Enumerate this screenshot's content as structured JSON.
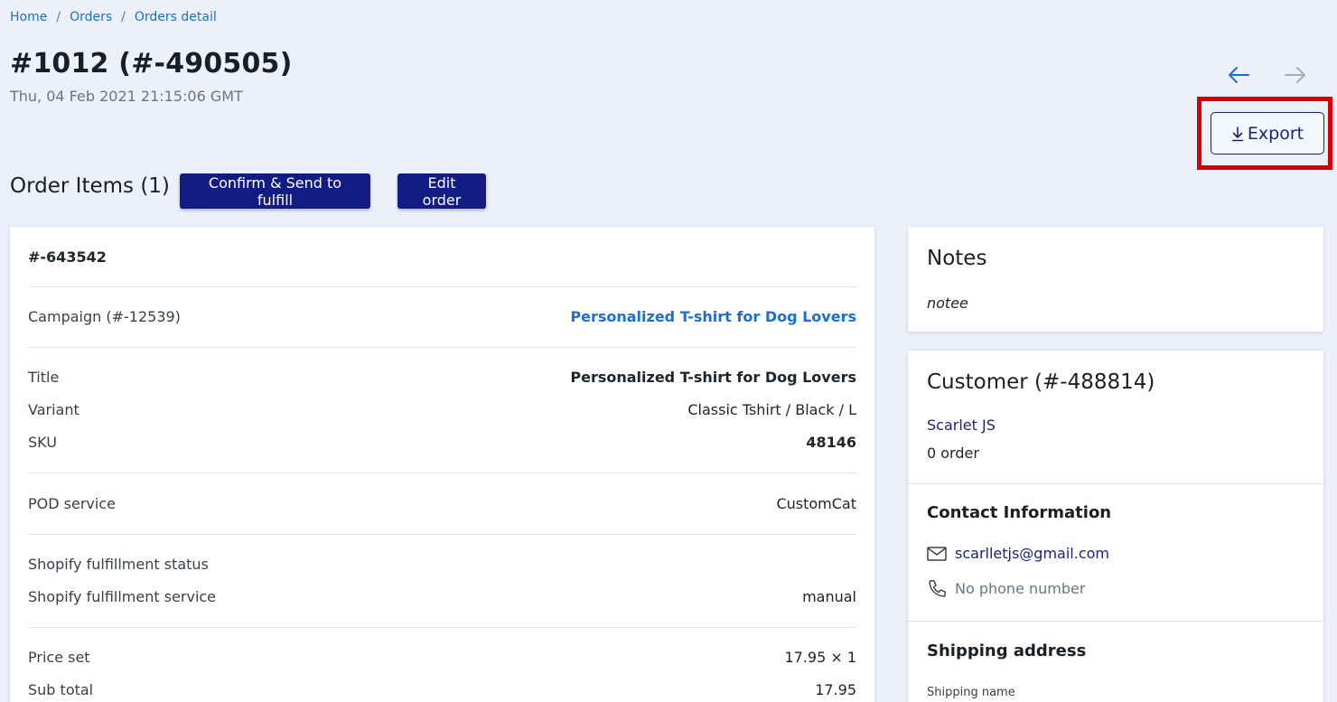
{
  "breadcrumb": {
    "items": [
      "Home",
      "Orders",
      "Orders detail"
    ],
    "separator": "/"
  },
  "order": {
    "title": "#1012 (#-490505)",
    "date": "Thu, 04 Feb 2021 21:15:06 GMT"
  },
  "nav": {
    "prev_icon": "arrow-left-icon",
    "next_icon": "arrow-right-icon"
  },
  "toolbar": {
    "export_label": "Export",
    "export_icon": "download-icon"
  },
  "items_section": {
    "title": "Order Items (1)",
    "confirm_label": "Confirm & Send to fulfill",
    "edit_label": "Edit order"
  },
  "item": {
    "id": "#-643542",
    "campaign_label": "Campaign (#-12539)",
    "campaign_value": "Personalized T-shirt for Dog Lovers",
    "title_label": "Title",
    "title_value": "Personalized T-shirt for Dog Lovers",
    "variant_label": "Variant",
    "variant_value": "Classic Tshirt / Black / L",
    "sku_label": "SKU",
    "sku_value": "48146",
    "pod_label": "POD service",
    "pod_value": "CustomCat",
    "shopify_status_label": "Shopify fulfillment status",
    "shopify_status_value": "",
    "shopify_service_label": "Shopify fulfillment service",
    "shopify_service_value": "manual",
    "price_set_label": "Price set",
    "price_set_value": "17.95 × 1",
    "subtotal_label": "Sub total",
    "subtotal_value": "17.95"
  },
  "notes": {
    "title": "Notes",
    "text": "notee"
  },
  "customer": {
    "title": "Customer (#-488814)",
    "name": "Scarlet JS",
    "orders": "0 order",
    "contact_title": "Contact Information",
    "email": "scarlletjs@gmail.com",
    "phone": "No phone number",
    "email_icon": "mail-icon",
    "phone_icon": "phone-icon",
    "shipping_title": "Shipping address",
    "shipping_name_label": "Shipping name"
  },
  "colors": {
    "background": "#ecf0fa",
    "primary_dark": "#131c82",
    "link": "#1a6fd6",
    "highlight": "#d50000"
  }
}
